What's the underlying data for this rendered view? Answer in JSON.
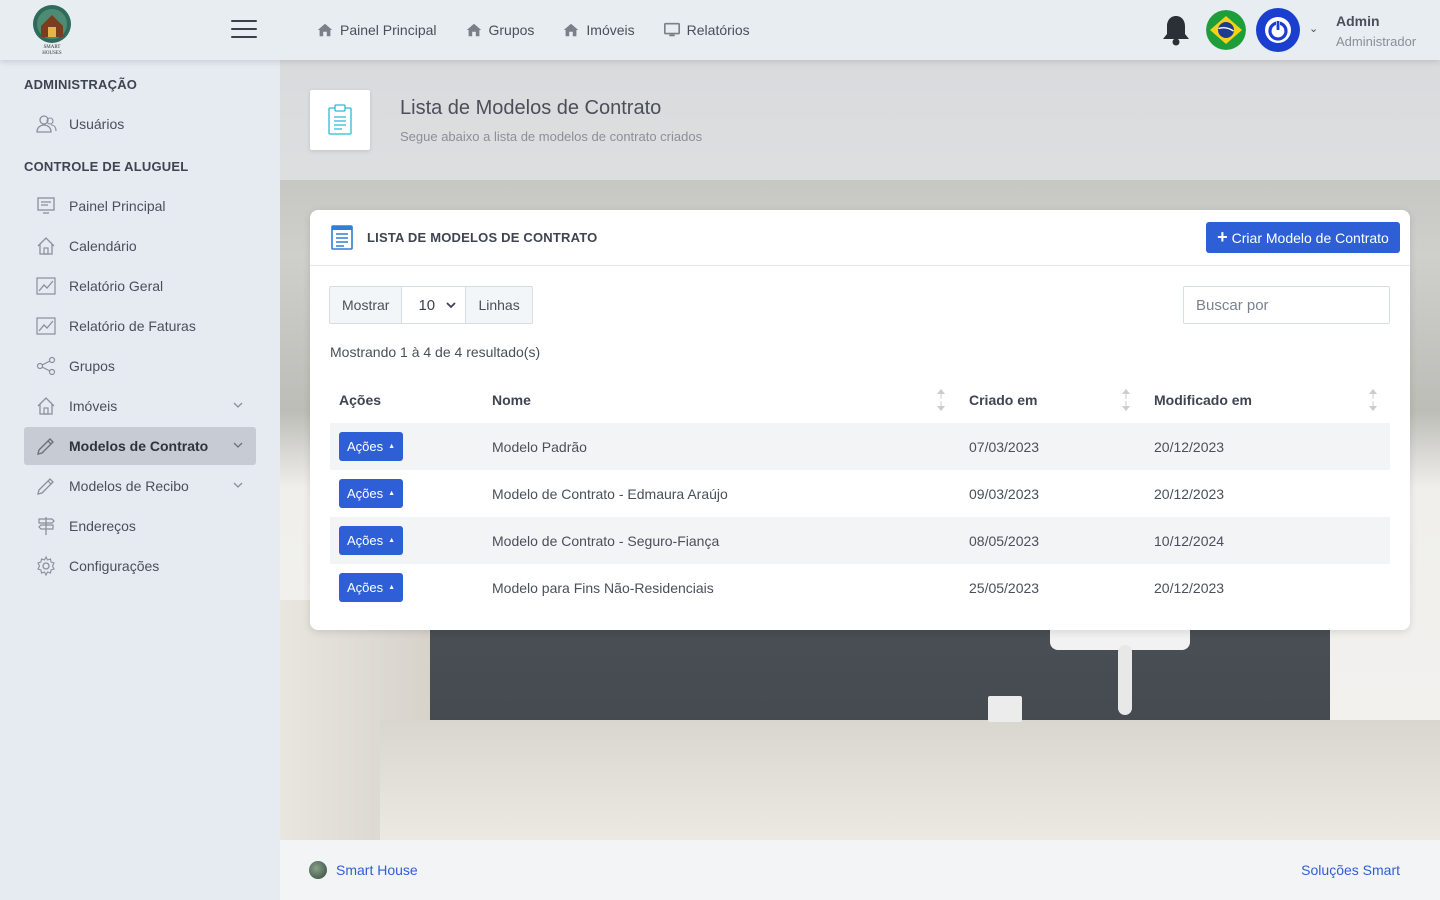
{
  "topbar": {
    "nav": [
      {
        "label": "Painel Principal",
        "icon": "home-icon"
      },
      {
        "label": "Grupos",
        "icon": "home-icon"
      },
      {
        "label": "Imóveis",
        "icon": "home-icon"
      },
      {
        "label": "Relatórios",
        "icon": "monitor-icon"
      }
    ],
    "user_name": "Admin",
    "user_role": "Administrador"
  },
  "sidebar": {
    "section_admin": "ADMINISTRAÇÃO",
    "section_rent": "CONTROLE DE ALUGUEL",
    "items": [
      {
        "label": "Usuários",
        "icon": "users-icon"
      },
      {
        "label": "Painel Principal",
        "icon": "dashboard-icon"
      },
      {
        "label": "Calendário",
        "icon": "home-outline-icon"
      },
      {
        "label": "Relatório Geral",
        "icon": "chart-line-icon"
      },
      {
        "label": "Relatório de Faturas",
        "icon": "chart-line-icon"
      },
      {
        "label": "Grupos",
        "icon": "share-icon"
      },
      {
        "label": "Imóveis",
        "icon": "home-outline-icon"
      },
      {
        "label": "Modelos de Contrato",
        "icon": "pencil-icon"
      },
      {
        "label": "Modelos de Recibo",
        "icon": "pencil-icon"
      },
      {
        "label": "Endereços",
        "icon": "signpost-icon"
      },
      {
        "label": "Configurações",
        "icon": "gear-icon"
      }
    ]
  },
  "page": {
    "title": "Lista de Modelos de Contrato",
    "subtitle": "Segue abaixo a lista de modelos de contrato criados"
  },
  "card": {
    "title": "LISTA DE MODELOS DE CONTRATO",
    "create_label": "Criar Modelo de Contrato",
    "show_label": "Mostrar",
    "page_size": "10",
    "lines_label": "Linhas",
    "search_placeholder": "Buscar por",
    "info": "Mostrando 1 à 4 de 4 resultado(s)",
    "columns": [
      "Ações",
      "Nome",
      "Criado em",
      "Modificado em"
    ],
    "action_label": "Ações",
    "rows": [
      {
        "nome": "Modelo Padrão",
        "criado": "07/03/2023",
        "modificado": "20/12/2023"
      },
      {
        "nome": "Modelo de Contrato - Edmaura Araújo",
        "criado": "09/03/2023",
        "modificado": "20/12/2023"
      },
      {
        "nome": "Modelo de Contrato - Seguro-Fiança",
        "criado": "08/05/2023",
        "modificado": "10/12/2024"
      },
      {
        "nome": "Modelo para Fins Não-Residenciais",
        "criado": "25/05/2023",
        "modificado": "20/12/2023"
      }
    ]
  },
  "footer": {
    "left": "Smart House",
    "right": "Soluções Smart"
  },
  "colors": {
    "primary": "#2f5fd7",
    "power": "#1a3fcf",
    "sidebar_bg": "#e6ebf1",
    "active_bg": "#c7ccd4"
  }
}
